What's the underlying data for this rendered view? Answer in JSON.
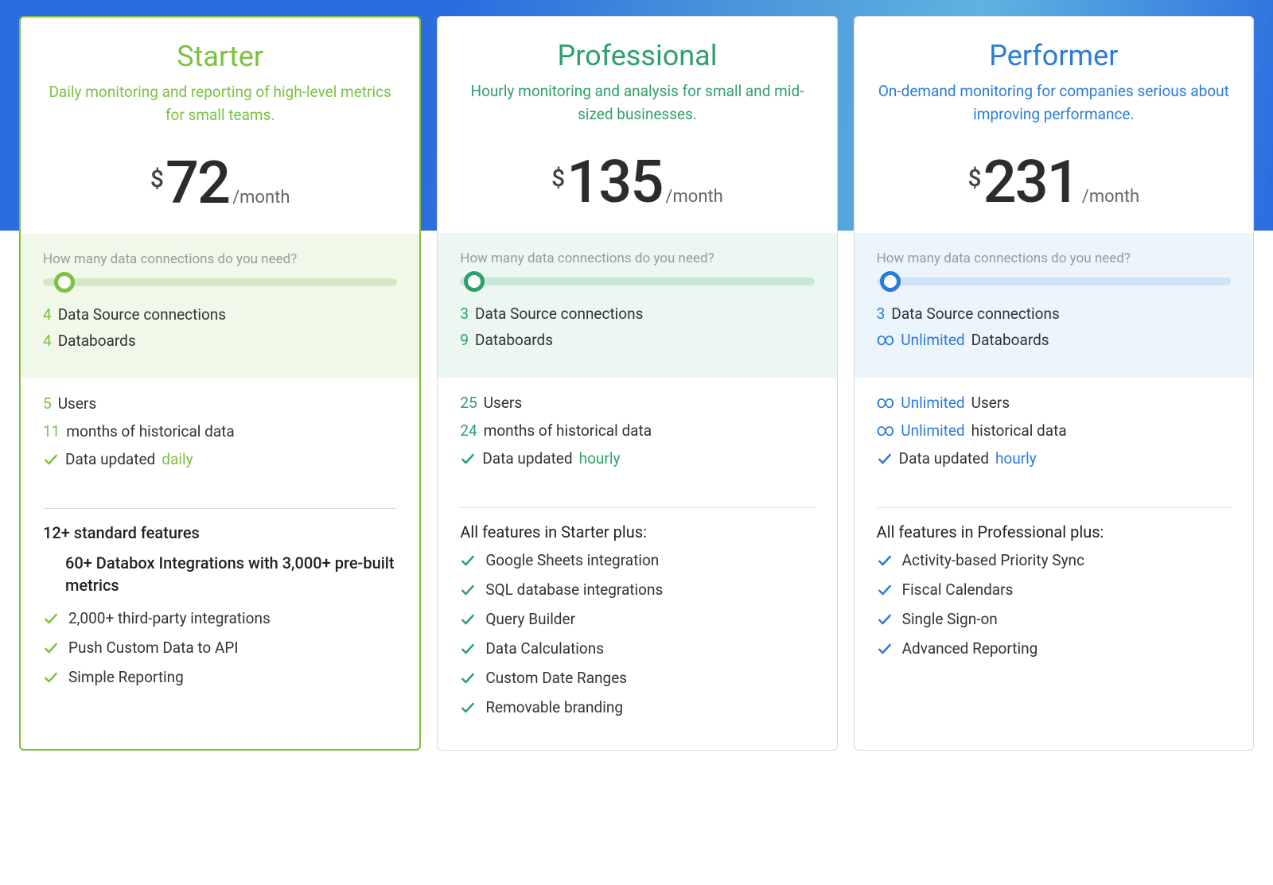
{
  "plans": [
    {
      "name": "Starter",
      "desc": "Daily monitoring and reporting of high-level metrics for small teams.",
      "price": "72",
      "period": "/month",
      "slider_q": "How many data connections do you need?",
      "connections_value": "4",
      "connections_label": "Data Source connections",
      "databoards_value": "4",
      "databoards_label": "Databoards",
      "users_value": "5",
      "users_label": "Users",
      "history_value": "11",
      "history_label": "months of historical data",
      "update_prefix": "Data updated",
      "update_freq": "daily",
      "heading_a": "12+ standard features",
      "heading_b": "60+ Databox Integrations with 3,000+ pre-built metrics",
      "features": [
        "2,000+ third-party integrations",
        "Push Custom Data to API",
        "Simple Reporting"
      ]
    },
    {
      "name": "Professional",
      "desc": "Hourly monitoring and analysis for small and mid-sized businesses.",
      "price": "135",
      "period": "/month",
      "slider_q": "How many data connections do you need?",
      "connections_value": "3",
      "connections_label": "Data Source connections",
      "databoards_value": "9",
      "databoards_label": "Databoards",
      "users_value": "25",
      "users_label": "Users",
      "history_value": "24",
      "history_label": "months of historical data",
      "update_prefix": "Data updated",
      "update_freq": "hourly",
      "feature_heading": "All features in Starter plus:",
      "features": [
        "Google Sheets integration",
        "SQL database integrations",
        "Query Builder",
        "Data Calculations",
        "Custom Date Ranges",
        "Removable branding"
      ]
    },
    {
      "name": "Performer",
      "desc": "On-demand monitoring for companies serious about improving performance.",
      "price": "231",
      "period": "/month",
      "slider_q": "How many data connections do you need?",
      "connections_value": "3",
      "connections_label": "Data Source connections",
      "databoards_unlimited": "Unlimited",
      "databoards_label": "Databoards",
      "users_unlimited": "Unlimited",
      "users_label": "Users",
      "history_unlimited": "Unlimited",
      "history_label": "historical data",
      "update_prefix": "Data updated",
      "update_freq": "hourly",
      "feature_heading": "All features in Professional plus:",
      "features": [
        "Activity-based Priority Sync",
        "Fiscal Calendars",
        "Single Sign-on",
        "Advanced Reporting"
      ]
    }
  ]
}
